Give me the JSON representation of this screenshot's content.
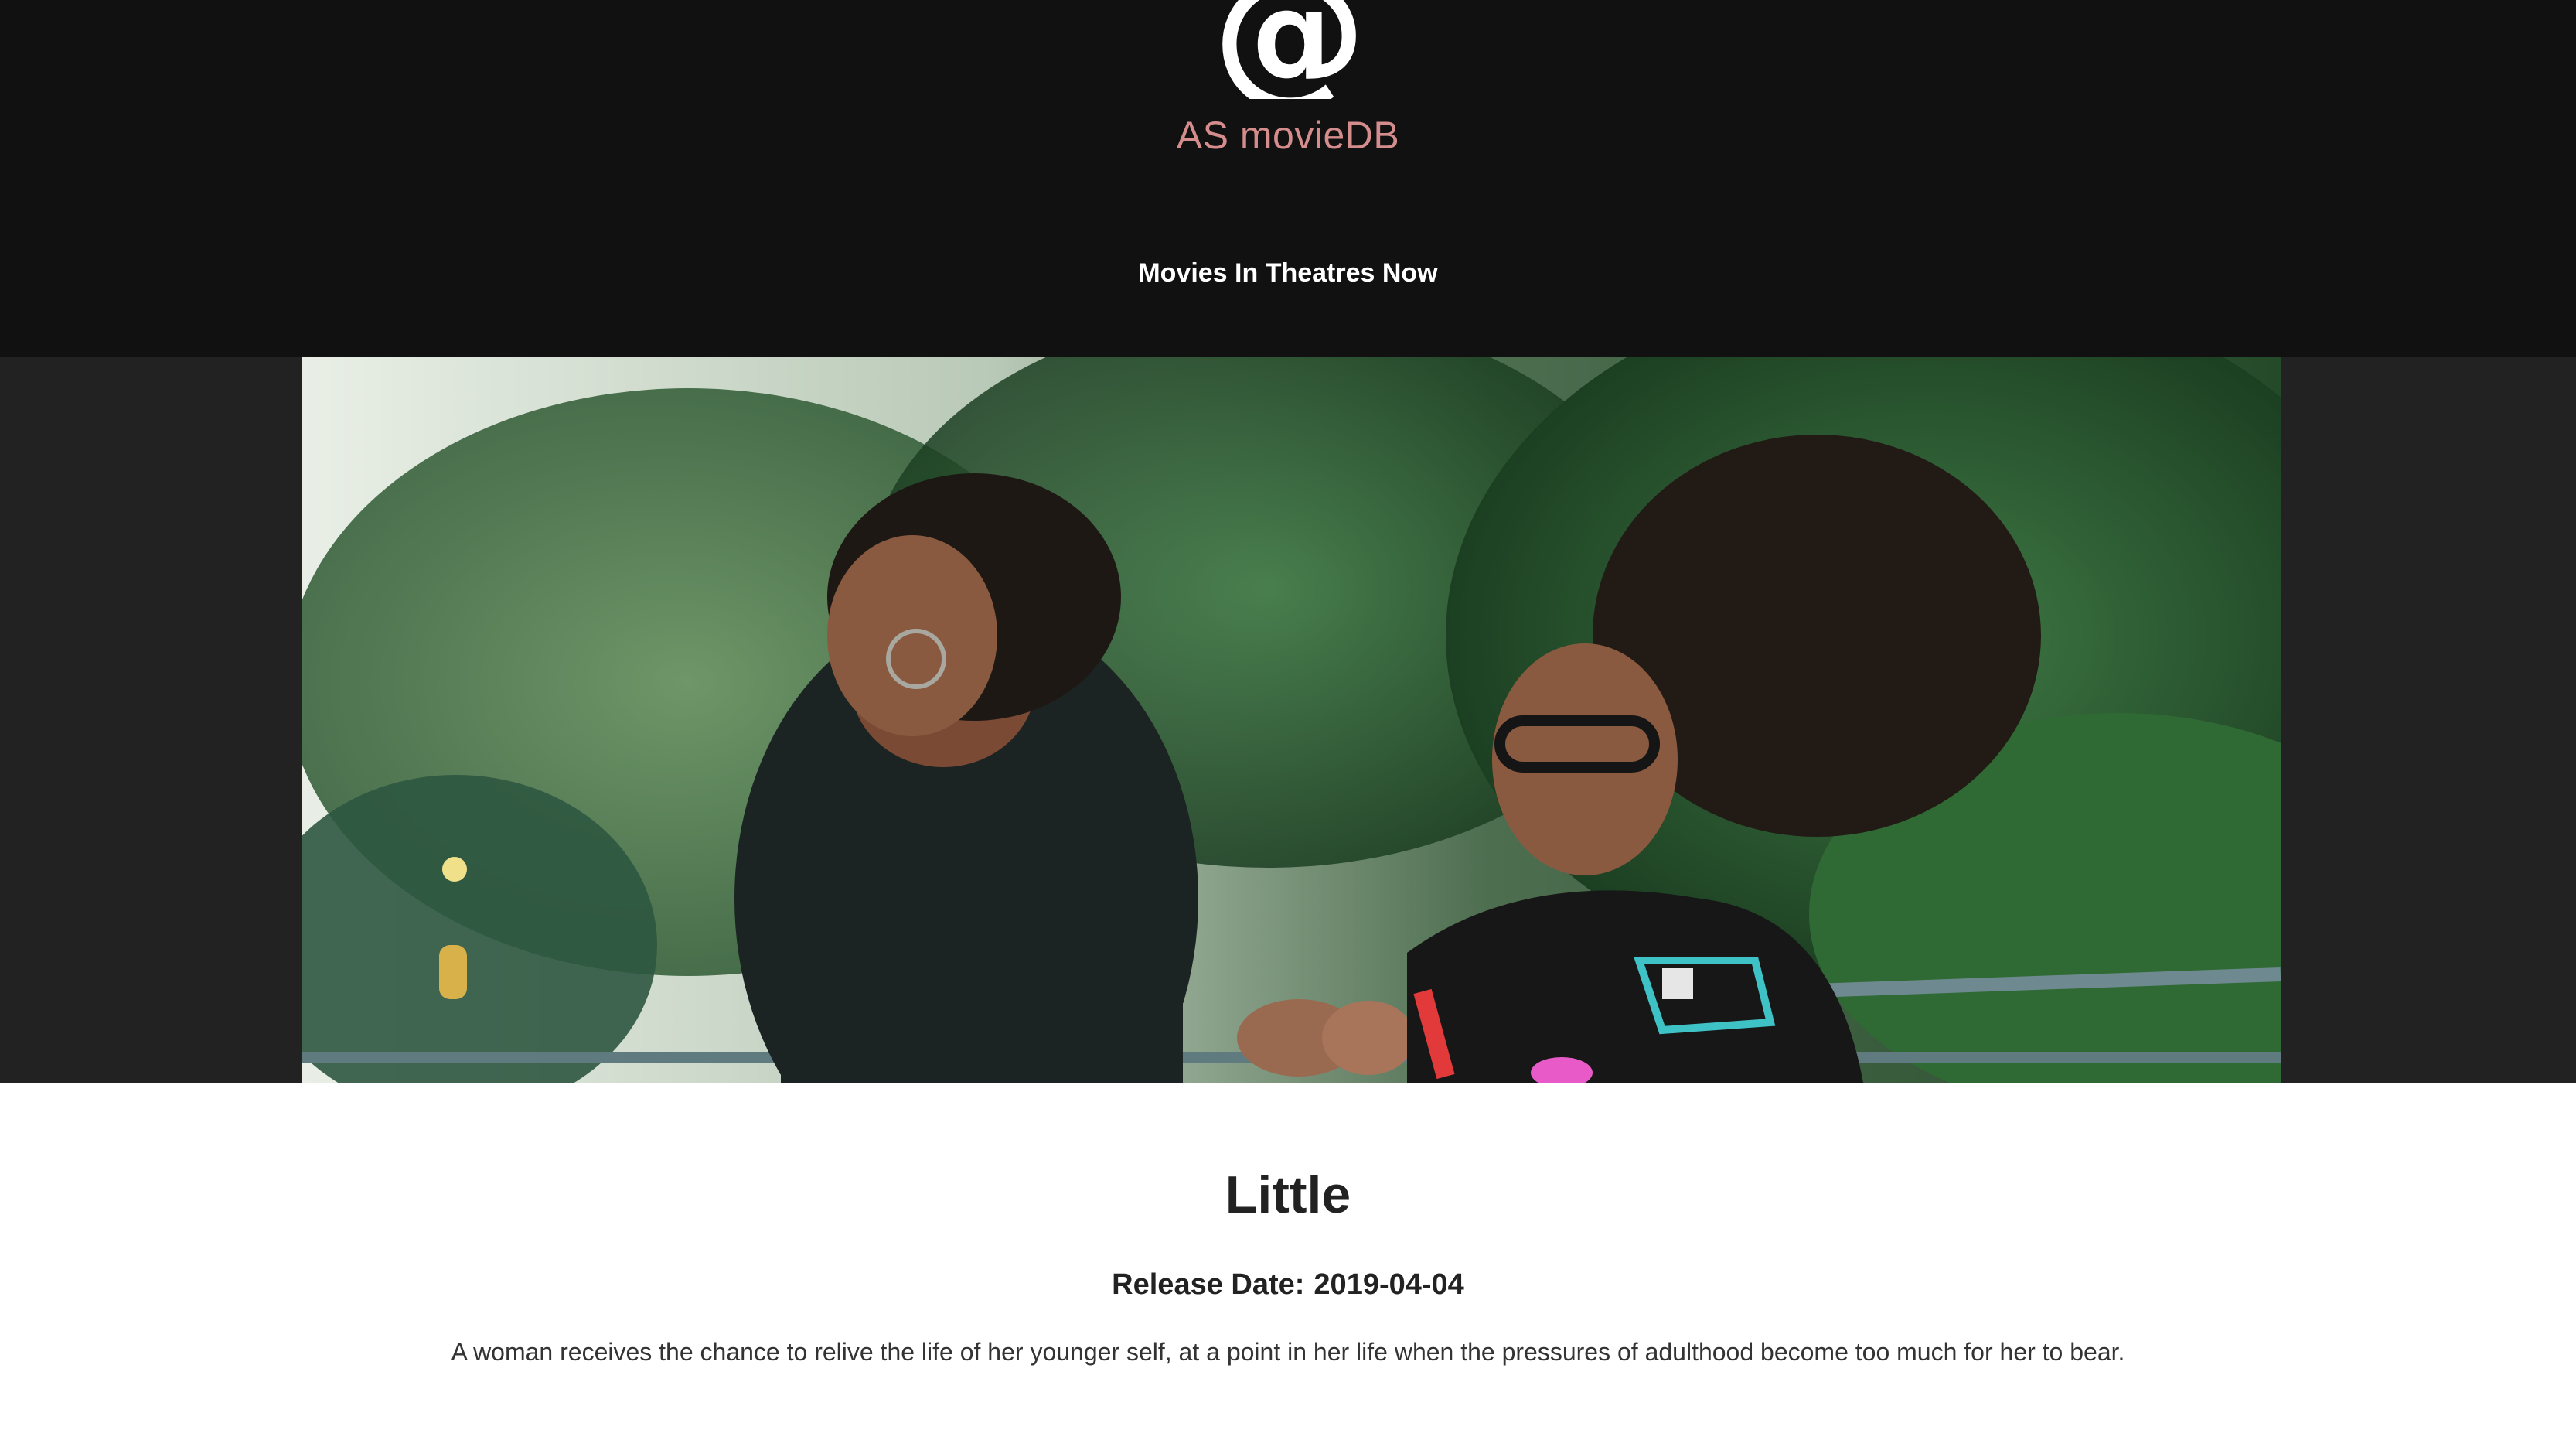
{
  "site": {
    "brand": "AS movieDB",
    "logo_icon": "at-sign-icon",
    "logo_glyph": "@",
    "brand_color": "#d48c8c",
    "header_bg": "#111111"
  },
  "nav": {
    "movies_in_theatres": "Movies In Theatres Now"
  },
  "movie": {
    "title": "Little",
    "release_label": "Release Date:",
    "release_date": "2019-04-04",
    "overview": "A woman receives the chance to relive the life of her younger self, at a point in her life when the pressures of adulthood become too much for her to bear.",
    "backdrop_alt": "Little backdrop"
  }
}
